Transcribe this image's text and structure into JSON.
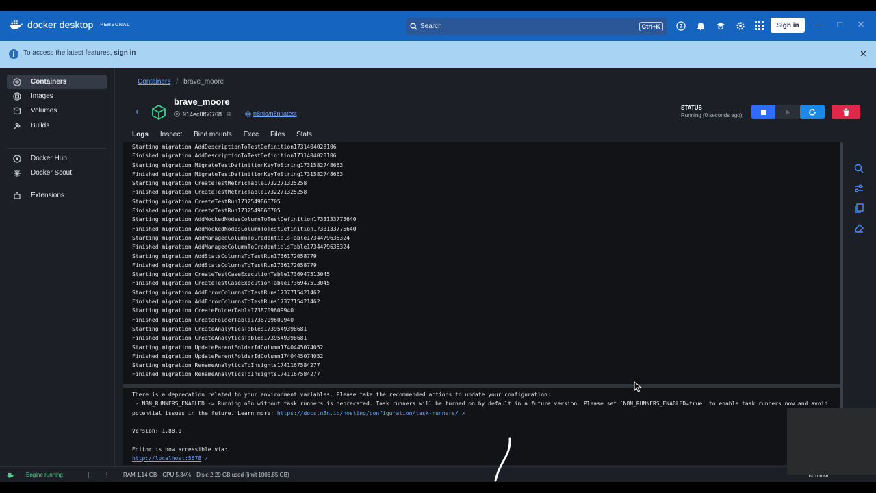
{
  "app": {
    "brand": "docker desktop",
    "plan": "PERSONAL",
    "search_placeholder": "Search",
    "search_shortcut": "Ctrl+K",
    "signin_label": "Sign in"
  },
  "banner": {
    "text": "To access the latest features, ",
    "link": "sign in"
  },
  "sidebar": {
    "items": [
      {
        "label": "Containers",
        "icon": "containers-icon",
        "active": true
      },
      {
        "label": "Images",
        "icon": "images-icon"
      },
      {
        "label": "Volumes",
        "icon": "volumes-icon"
      },
      {
        "label": "Builds",
        "icon": "builds-icon"
      },
      {
        "label": "Docker Hub",
        "icon": "docker-hub-icon"
      },
      {
        "label": "Docker Scout",
        "icon": "docker-scout-icon"
      },
      {
        "label": "Extensions",
        "icon": "extensions-icon"
      }
    ]
  },
  "breadcrumb": {
    "parent": "Containers",
    "current": "brave_moore"
  },
  "container": {
    "name": "brave_moore",
    "id": "914ec0f66768",
    "image": "n8nio/n8n:latest",
    "status_label": "STATUS",
    "status_value": "Running (0 seconds ago)"
  },
  "tabs": [
    "Logs",
    "Inspect",
    "Bind mounts",
    "Exec",
    "Files",
    "Stats"
  ],
  "logs": {
    "lines": [
      "Starting migration AddDescriptionToTestDefinition1731404028106",
      "Finished migration AddDescriptionToTestDefinition1731404028106",
      "Starting migration MigrateTestDefinitionKeyToString1731582748663",
      "Finished migration MigrateTestDefinitionKeyToString1731582748663",
      "Starting migration CreateTestMetricTable1732271325258",
      "Finished migration CreateTestMetricTable1732271325258",
      "Starting migration CreateTestRun1732549866705",
      "Finished migration CreateTestRun1732549866705",
      "Starting migration AddMockedNodesColumnToTestDefinition1733133775640",
      "Finished migration AddMockedNodesColumnToTestDefinition1733133775640",
      "Starting migration AddManagedColumnToCredentialsTable1734479635324",
      "Finished migration AddManagedColumnToCredentialsTable1734479635324",
      "Starting migration AddStatsColumnsToTestRun1736172058779",
      "Finished migration AddStatsColumnsToTestRun1736172058779",
      "Starting migration CreateTestCaseExecutionTable1736947513045",
      "Finished migration CreateTestCaseExecutionTable1736947513045",
      "Starting migration AddErrorColumnsToTestRuns1737715421462",
      "Finished migration AddErrorColumnsToTestRuns1737715421462",
      "Starting migration CreateFolderTable1738709609940",
      "Finished migration CreateFolderTable1738709609940",
      "Starting migration CreateAnalyticsTables1739549398681",
      "Finished migration CreateAnalyticsTables1739549398681",
      "Starting migration UpdateParentFolderIdColumn1740445074052",
      "Finished migration UpdateParentFolderIdColumn1740445074052",
      "Starting migration RenameAnalyticsToInsights1741167584277",
      "Finished migration RenameAnalyticsToInsights1741167584277"
    ],
    "deprecation_1": "There is a deprecation related to your environment variables. Please take the recommended actions to update your configuration:",
    "deprecation_2": " - N8N_RUNNERS_ENABLED -> Running n8n without task runners is deprecated. Task runners will be turned on by default in a future version. Please set `N8N_RUNNERS_ENABLED=true` to enable task runners now and avoid",
    "deprecation_3": "potential issues in the future. Learn more: ",
    "deprecation_link": "https://docs.n8n.io/hosting/configuration/task-runners/",
    "version": "Version: 1.88.0",
    "editor_line": "Editor is now accessible via:",
    "editor_link": "http://localhost:5678"
  },
  "statusbar": {
    "engine": "Engine running",
    "ram": "RAM 1.14 GB",
    "cpu": "CPU 5.34%",
    "disk": "Disk: 2.29 GB used (limit 1006.85 GB)",
    "right": "Terminal"
  },
  "colors": {
    "titlebar": "#1565c0",
    "banner": "#a9d3f2",
    "accent_link": "#6ea8ff",
    "stop_button": "#2f6bff",
    "restart_button": "#1e88e5",
    "delete_button": "#e0284a",
    "engine_running": "#4fd18b"
  }
}
